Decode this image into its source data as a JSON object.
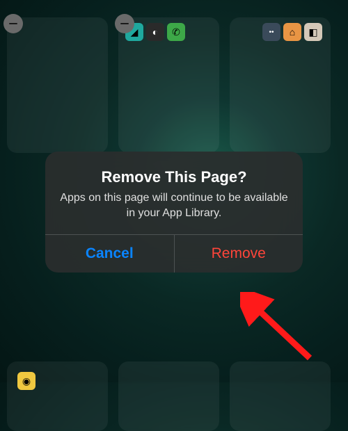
{
  "dialog": {
    "title": "Remove This Page?",
    "message": "Apps on this page will continue to be available in your App Library.",
    "cancel_label": "Cancel",
    "remove_label": "Remove"
  },
  "pages": {
    "thumbs": [
      {
        "has_remove_badge": true,
        "apps": []
      },
      {
        "has_remove_badge": true,
        "apps": [
          "teal",
          "dark",
          "green"
        ]
      },
      {
        "has_remove_badge": false,
        "apps": [
          "blue",
          "orange",
          "white"
        ]
      }
    ]
  },
  "icons": {
    "minus": "minus-icon",
    "arrow": "arrow-pointer-icon"
  },
  "colors": {
    "accent_blue": "#0a84ff",
    "destructive_red": "#ff453a",
    "background_teal": "#0a2824"
  }
}
